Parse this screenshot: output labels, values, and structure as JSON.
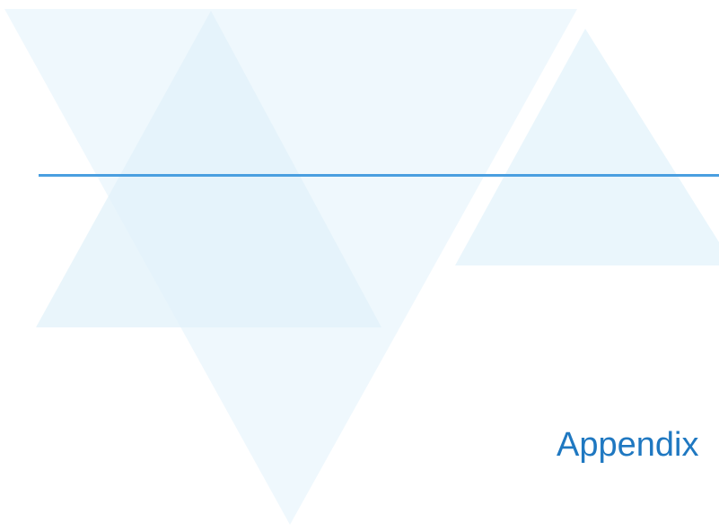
{
  "slide": {
    "title": "Appendix"
  },
  "theme": {
    "accent": "#4a9fe0",
    "title_color": "#1f78c1",
    "shape_tint": "#e6f4fb"
  }
}
